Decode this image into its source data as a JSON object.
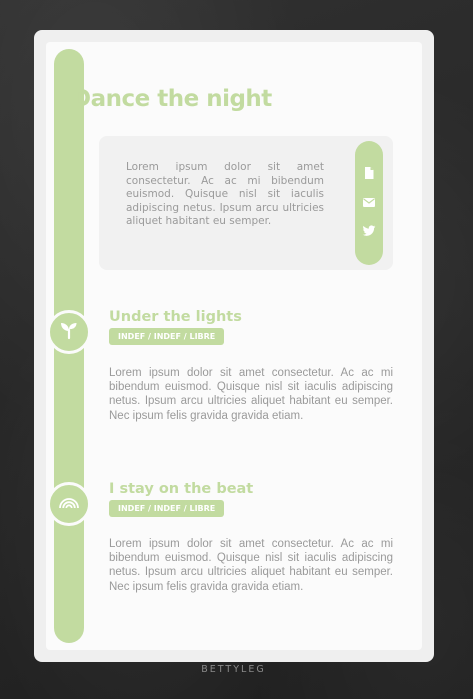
{
  "page": {
    "title": "Dance the night",
    "credit": "BETTYLEG"
  },
  "intro": {
    "text": "Lorem ipsum dolor sit amet consectetur. Ac ac mi bibendum euismod. Quisque nisl sit iaculis adipiscing netus. Ipsum arcu ultricies aliquet habitant eu semper.",
    "social_icons": [
      "document-icon",
      "envelope-icon",
      "twitter-icon"
    ]
  },
  "sections": [
    {
      "icon": "sprout-icon",
      "title": "Under the lights",
      "tags": "INDEF / INDEF / LIBRE",
      "body": "Lorem ipsum dolor sit amet consectetur. Ac ac mi bibendum euismod. Quisque nisl sit iaculis adipiscing netus. Ipsum arcu ultricies aliquet habitant eu semper. Nec ipsum felis gravida gravida etiam."
    },
    {
      "icon": "rainbow-icon",
      "title": "I stay on the beat",
      "tags": "INDEF / INDEF / LIBRE",
      "body": "Lorem ipsum dolor sit amet consectetur. Ac ac mi bibendum euismod. Quisque nisl sit iaculis adipiscing netus. Ipsum arcu ultricies aliquet habitant eu semper. Nec ipsum felis gravida gravida etiam."
    }
  ],
  "colors": {
    "accent": "#c2dba0",
    "card": "#fbfbfb",
    "text": "#9a9a9a"
  }
}
